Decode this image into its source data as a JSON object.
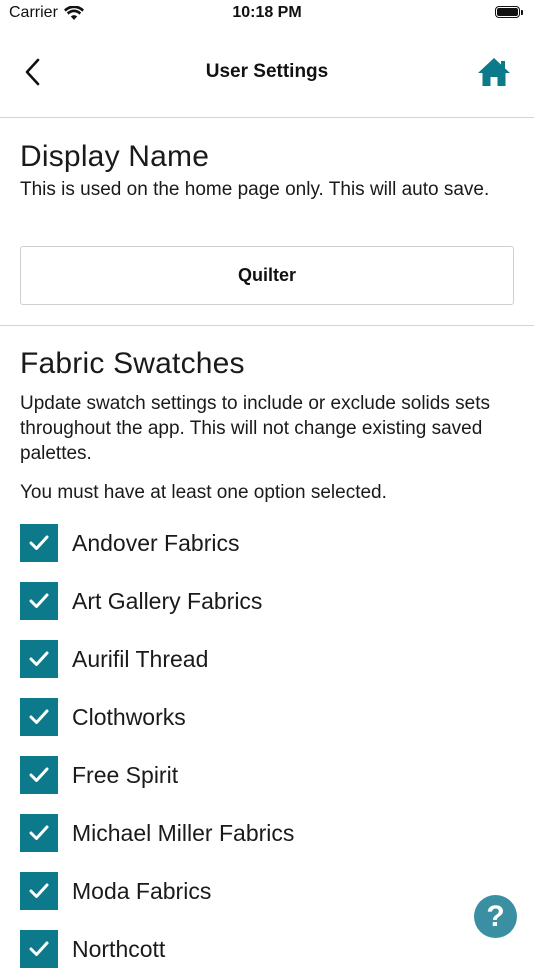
{
  "status_bar": {
    "carrier": "Carrier",
    "time": "10:18 PM"
  },
  "nav": {
    "title": "User Settings",
    "back_icon": "chevron-left-icon",
    "home_icon": "home-icon"
  },
  "display_name": {
    "title": "Display Name",
    "description": "This is used on the home page only. This will auto save.",
    "value": "Quilter"
  },
  "fabric_swatches": {
    "title": "Fabric Swatches",
    "description": "Update swatch settings to include or exclude solids sets throughout the app. This will not change existing saved palettes.",
    "note": "You must have at least one option selected.",
    "items": [
      {
        "label": "Andover Fabrics",
        "checked": true
      },
      {
        "label": "Art Gallery Fabrics",
        "checked": true
      },
      {
        "label": "Aurifil Thread",
        "checked": true
      },
      {
        "label": "Clothworks",
        "checked": true
      },
      {
        "label": "Free Spirit",
        "checked": true
      },
      {
        "label": "Michael Miller Fabrics",
        "checked": true
      },
      {
        "label": "Moda Fabrics",
        "checked": true
      },
      {
        "label": "Northcott",
        "checked": true
      }
    ]
  },
  "help": {
    "label": "?"
  },
  "colors": {
    "accent": "#0d7a8c",
    "help_button": "#3a8fa3",
    "divider": "#d4d4d4"
  }
}
